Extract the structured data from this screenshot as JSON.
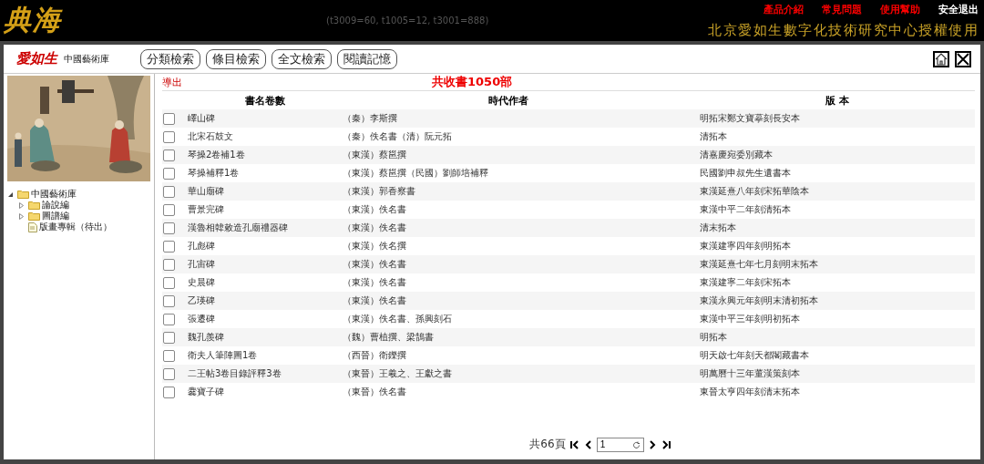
{
  "header": {
    "logo": "典海",
    "debug_text": "(t3009=60, t1005=12, t3001=888)",
    "links": [
      {
        "label": "產品介紹",
        "color": "#ff0000"
      },
      {
        "label": "常見問題",
        "color": "#ff0000"
      },
      {
        "label": "使用幫助",
        "color": "#ff0000"
      },
      {
        "label": "安全退出",
        "color": "#ffffff"
      }
    ],
    "license": "北京愛如生數字化技術研究中心授權使用"
  },
  "toolbar": {
    "brand": "愛如生",
    "library": "中國藝術庫",
    "buttons": [
      "分類檢索",
      "條目檢索",
      "全文檢索",
      "閱讀記憶"
    ]
  },
  "sidebar": {
    "tree": [
      {
        "label": "中國藝術庫",
        "kind": "folder",
        "expanded": true,
        "children": [
          {
            "label": "論說編",
            "kind": "folder",
            "expanded": false
          },
          {
            "label": "圖譜編",
            "kind": "folder",
            "expanded": false
          },
          {
            "label": "版畫專輯（待出）",
            "kind": "doc"
          }
        ]
      }
    ]
  },
  "main": {
    "export": "導出",
    "title": "共收書1050部",
    "columns": [
      "書名卷數",
      "時代作者",
      "版 本"
    ],
    "rows": [
      {
        "title": "嶧山碑",
        "author": "（秦）李斯撰",
        "edition": "明拓宋鄭文寶摹刻長安本",
        "checked": false
      },
      {
        "title": "北宋石鼓文",
        "author": "（秦）佚名書（清）阮元拓",
        "edition": "清拓本",
        "checked": false
      },
      {
        "title": "琴操2卷補1卷",
        "author": "（東漢）蔡邕撰",
        "edition": "清嘉慶宛委別藏本",
        "checked": false
      },
      {
        "title": "琴操補釋1卷",
        "author": "（東漢）蔡邕撰（民國）劉師培補釋",
        "edition": "民國劉申叔先生遺書本",
        "checked": false
      },
      {
        "title": "華山廟碑",
        "author": "（東漢）郭香察書",
        "edition": "東漢延熹八年刻宋拓華陰本",
        "checked": false
      },
      {
        "title": "曹景完碑",
        "author": "（東漢）佚名書",
        "edition": "東漢中平二年刻清拓本",
        "checked": false
      },
      {
        "title": "漢魯相韓敕造孔廟禮器碑",
        "author": "（東漢）佚名書",
        "edition": "清末拓本",
        "checked": false
      },
      {
        "title": "孔彪碑",
        "author": "（東漢）佚名撰",
        "edition": "東漢建寧四年刻明拓本",
        "checked": false
      },
      {
        "title": "孔宙碑",
        "author": "（東漢）佚名書",
        "edition": "東漢延熹七年七月刻明末拓本",
        "checked": false
      },
      {
        "title": "史晨碑",
        "author": "（東漢）佚名書",
        "edition": "東漢建寧二年刻宋拓本",
        "checked": false
      },
      {
        "title": "乙瑛碑",
        "author": "（東漢）佚名書",
        "edition": "東漢永興元年刻明末清初拓本",
        "checked": false
      },
      {
        "title": "張遷碑",
        "author": "（東漢）佚名書、孫興刻石",
        "edition": "東漢中平三年刻明初拓本",
        "checked": false
      },
      {
        "title": "魏孔羨碑",
        "author": "（魏）曹植撰、梁鵠書",
        "edition": "明拓本",
        "checked": false
      },
      {
        "title": "衛夫人筆陣圖1卷",
        "author": "（西晉）衛鑠撰",
        "edition": "明天啟七年刻天都閣藏書本",
        "checked": false
      },
      {
        "title": "二王帖3卷目錄評釋3卷",
        "author": "（東晉）王羲之、王獻之書",
        "edition": "明萬曆十三年董漢策刻本",
        "checked": false
      },
      {
        "title": "爨寶子碑",
        "author": "（東晉）佚名書",
        "edition": "東晉太亨四年刻清末拓本",
        "checked": false
      }
    ]
  },
  "pager": {
    "total": "共66頁",
    "page": "1"
  }
}
